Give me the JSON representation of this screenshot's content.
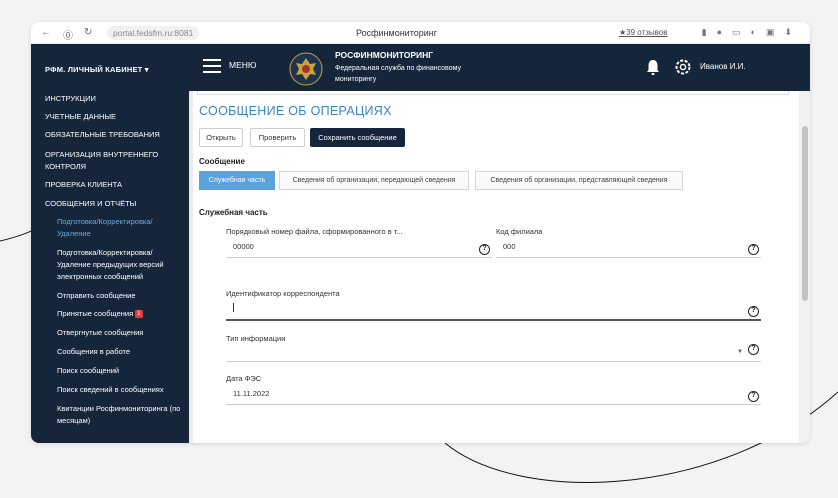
{
  "browser": {
    "url": "portal.fedsfm.ru:8081",
    "tab_title": "Росфинмониторинг",
    "reviews": "★39 отзывов"
  },
  "header": {
    "cabinet_menu": "РФМ. ЛИЧНЫЙ КАБИНЕТ ▾",
    "menu_label": "МЕНЮ",
    "brand_title": "РОСФИНМОНИТОРИНГ",
    "brand_subtitle": "Федеральная служба по финансовому мониторингу",
    "user_name": "Иванов И.И."
  },
  "sidebar": {
    "items": [
      "ИНСТРУКЦИИ",
      "УЧЕТНЫЕ ДАННЫЕ",
      "ОБЯЗАТЕЛЬНЫЕ ТРЕБОВАНИЯ",
      "ОРГАНИЗАЦИЯ ВНУТРЕННЕГО КОНТРОЛЯ",
      "ПРОВЕРКА КЛИЕНТА",
      "СООБЩЕНИЯ И ОТЧЁТЫ"
    ],
    "subitems": [
      "Подготовка/Корректировка/Удаление",
      "Подготовка/Корректировка/Удаление предыдущих версий электронных сообщений",
      "Отправить сообщение",
      "Принятые сообщения",
      "Отвергнутые сообщения",
      "Сообщения в работе",
      "Поиск сообщений",
      "Поиск сведений в сообщениях",
      "Квитанции Росфинмониторинга (по месяцам)"
    ],
    "accepted_badge": "1"
  },
  "main": {
    "page_title": "СООБЩЕНИЕ ОБ ОПЕРАЦИЯХ",
    "buttons": {
      "open": "Открыть",
      "check": "Проверить",
      "save": "Сохранить сообщение"
    },
    "section_message": "Сообщение",
    "tabs": [
      "Служебная часть",
      "Сведения об организации, передающей сведения",
      "Сведения об организации, представляющей сведения"
    ],
    "section_service": "Служебная часть",
    "fields": {
      "file_number": {
        "label": "Порядковый номер файла, сформированного в т...",
        "value": "00000"
      },
      "branch_code": {
        "label": "Код филиала",
        "value": "000"
      },
      "correspondent_id": {
        "label": "Идентификатор корреспондента",
        "value": ""
      },
      "info_type": {
        "label": "Тип информации",
        "value": ""
      },
      "fes_date": {
        "label": "Дата ФЭС",
        "value": "11.11.2022"
      }
    }
  },
  "colors": {
    "navy": "#15263a",
    "accent": "#3b86c5",
    "tab_active": "#5aa2de",
    "badge": "#e53935"
  }
}
